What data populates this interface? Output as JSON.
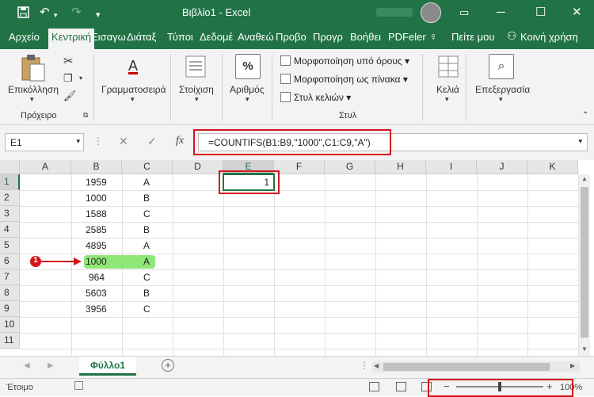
{
  "titlebar": {
    "title": "Βιβλίο1  -  Excel",
    "save_icon": "save-icon",
    "undo_icon": "undo-icon",
    "redo_icon": "redo-icon",
    "qat_icon": "customize-icon",
    "minimize": "─",
    "ribbon_options": "▭",
    "maximize": "☐",
    "close": "✕"
  },
  "tabs": [
    "Αρχείο",
    "Κεντρική",
    "Εισαγω",
    "Διάταξ",
    "Τύποι",
    "Δεδομέ",
    "Αναθεώ",
    "Προβο",
    "Προγρ",
    "Βοήθει",
    "PDFeler",
    "Πείτε μου",
    "Κοινή χρήση"
  ],
  "ribbon": {
    "paste_label": "Επικόλληση",
    "clipboard_group": "Πρόχειρο",
    "font_label": "Γραμματοσειρά",
    "alignment_label": "Στοίχιση",
    "number_label": "Αριθμός",
    "number_icon": "%",
    "font_icon": "A",
    "conditional_formatting": "Μορφοποίηση υπό όρους",
    "format_as_table": "Μορφοποίηση ως πίνακα",
    "cell_styles": "Στυλ κελιών",
    "styles_group": "Στυλ",
    "cells_label": "Κελιά",
    "editing_label": "Επεξεργασία"
  },
  "formula_bar": {
    "name_box": "E1",
    "fx": "fx",
    "cancel": "✕",
    "enter": "✓",
    "formula": "=COUNTIFS(B1:B9,\"1000\",C1:C9,\"A\")"
  },
  "grid": {
    "columns": [
      "A",
      "B",
      "C",
      "D",
      "E",
      "F",
      "G",
      "H",
      "I",
      "J",
      "K"
    ],
    "rows": [
      "1",
      "2",
      "3",
      "4",
      "5",
      "6",
      "7",
      "8",
      "9",
      "10",
      "11"
    ],
    "col_b": [
      "1959",
      "1000",
      "1588",
      "2585",
      "4895",
      "1000",
      "964",
      "5603",
      "3956"
    ],
    "col_c": [
      "A",
      "B",
      "C",
      "B",
      "A",
      "A",
      "C",
      "B",
      "C"
    ],
    "e1": "1"
  },
  "annotation": {
    "marker": "1"
  },
  "sheets": {
    "active": "Φύλλο1",
    "add": "+"
  },
  "status": {
    "text": "Έτοιμο",
    "zoom": "100%"
  },
  "colors": {
    "excel_green": "#217346",
    "highlight": "#7be35f",
    "annotation_red": "#d4141c"
  }
}
